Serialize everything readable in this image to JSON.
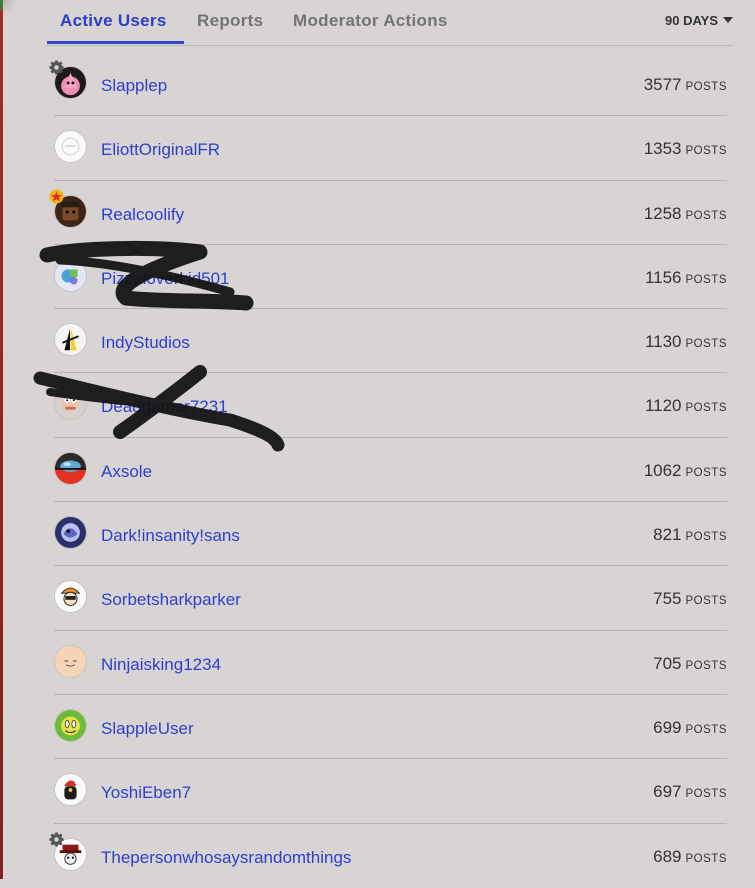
{
  "tabs": [
    {
      "label": "Active Users",
      "active": true
    },
    {
      "label": "Reports",
      "active": false
    },
    {
      "label": "Moderator Actions",
      "active": false
    }
  ],
  "period_filter": "90 DAYS",
  "post_unit": "POSTS",
  "colors": {
    "accent": "#2d40cc",
    "background": "#d9d4d4"
  },
  "users": [
    {
      "name": "Slapplep",
      "posts": "3577",
      "badge": "gear-icon"
    },
    {
      "name": "EliottOriginalFR",
      "posts": "1353",
      "badge": null
    },
    {
      "name": "Realcoolify",
      "posts": "1258",
      "badge": "star-icon"
    },
    {
      "name": "Pizzaloverkid501",
      "posts": "1156",
      "badge": null,
      "scribbled": true
    },
    {
      "name": "IndyStudios",
      "posts": "1130",
      "badge": null
    },
    {
      "name": "Deadgamer7231",
      "posts": "1120",
      "badge": null,
      "scribbled": true
    },
    {
      "name": "Axsole",
      "posts": "1062",
      "badge": null
    },
    {
      "name": "Dark!insanity!sans",
      "posts": "821",
      "badge": null
    },
    {
      "name": "Sorbetsharkparker",
      "posts": "755",
      "badge": null
    },
    {
      "name": "Ninjaisking1234",
      "posts": "705",
      "badge": null
    },
    {
      "name": "SlappleUser",
      "posts": "699",
      "badge": null
    },
    {
      "name": "YoshiEben7",
      "posts": "697",
      "badge": null
    },
    {
      "name": "Thepersonwhosaysrandomthings",
      "posts": "689",
      "badge": "gear-icon"
    }
  ]
}
